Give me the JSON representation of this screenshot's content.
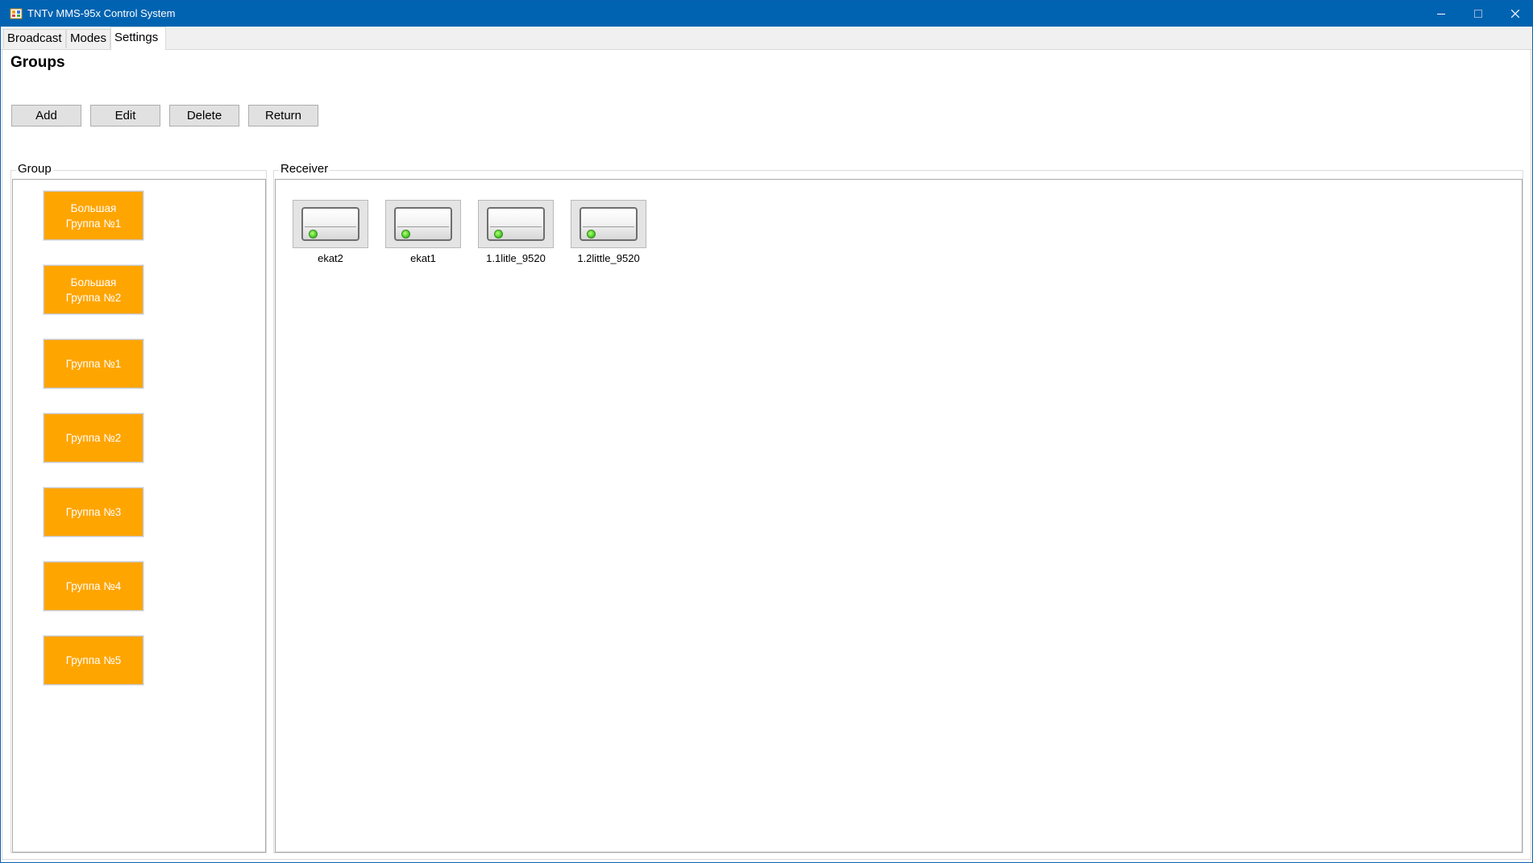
{
  "window": {
    "title": "TNTv MMS-95x Control System",
    "accent": "#0063b1"
  },
  "tabs": [
    {
      "label": "Broadcast",
      "active": false
    },
    {
      "label": "Modes",
      "active": false
    },
    {
      "label": "Settings",
      "active": true
    }
  ],
  "page": {
    "title": "Groups"
  },
  "toolbar": {
    "add_label": "Add",
    "edit_label": "Edit",
    "delete_label": "Delete",
    "return_label": "Return"
  },
  "group_panel": {
    "title": "Group",
    "button_color": "#ffa500",
    "items": [
      {
        "label": "Большая\nГруппа №1"
      },
      {
        "label": "Большая\nГруппа №2"
      },
      {
        "label": "Группа №1"
      },
      {
        "label": "Группа №2"
      },
      {
        "label": "Группа №3"
      },
      {
        "label": "Группа №4"
      },
      {
        "label": "Группа №5"
      }
    ]
  },
  "receiver_panel": {
    "title": "Receiver",
    "items": [
      {
        "label": "ekat2",
        "status": "online"
      },
      {
        "label": "ekat1",
        "status": "online"
      },
      {
        "label": "1.1litle_9520",
        "status": "online"
      },
      {
        "label": "1.2little_9520",
        "status": "online"
      }
    ]
  }
}
